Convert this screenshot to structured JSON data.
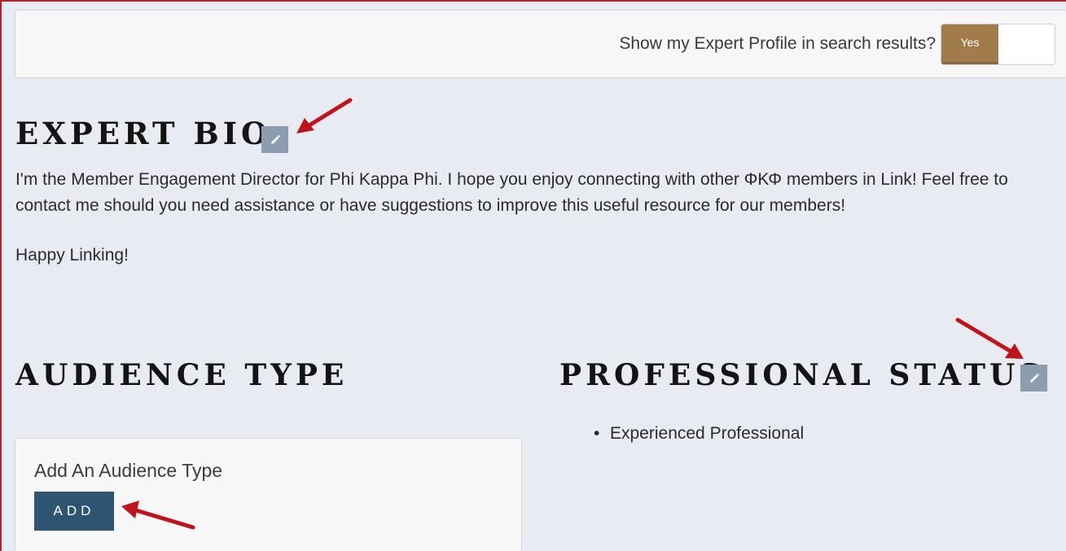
{
  "search_visibility": {
    "question": "Show my Expert Profile in search results?",
    "toggle_on_label": "Yes"
  },
  "expert_bio": {
    "heading": "EXPERT BIO",
    "paragraphs": [
      "I'm the Member Engagement Director for Phi Kappa Phi. I hope you enjoy connecting with other ΦΚΦ members in Link! Feel free to contact me should you need assistance or have suggestions to improve this useful resource for our members!",
      "Happy Linking!"
    ]
  },
  "audience_type": {
    "heading": "AUDIENCE TYPE",
    "card_title": "Add An Audience Type",
    "add_label": "ADD"
  },
  "professional_status": {
    "heading": "PROFESSIONAL STATUS",
    "items": [
      "Experienced Professional"
    ]
  },
  "icons": {
    "edit": "pencil-icon",
    "annotation": "red-arrow"
  },
  "colors": {
    "toggle_on": "#a07c4a",
    "edit_button": "#8c9db0",
    "add_button": "#2e5471",
    "annotation_arrow": "#c0141c",
    "frame": "#b1232b"
  }
}
